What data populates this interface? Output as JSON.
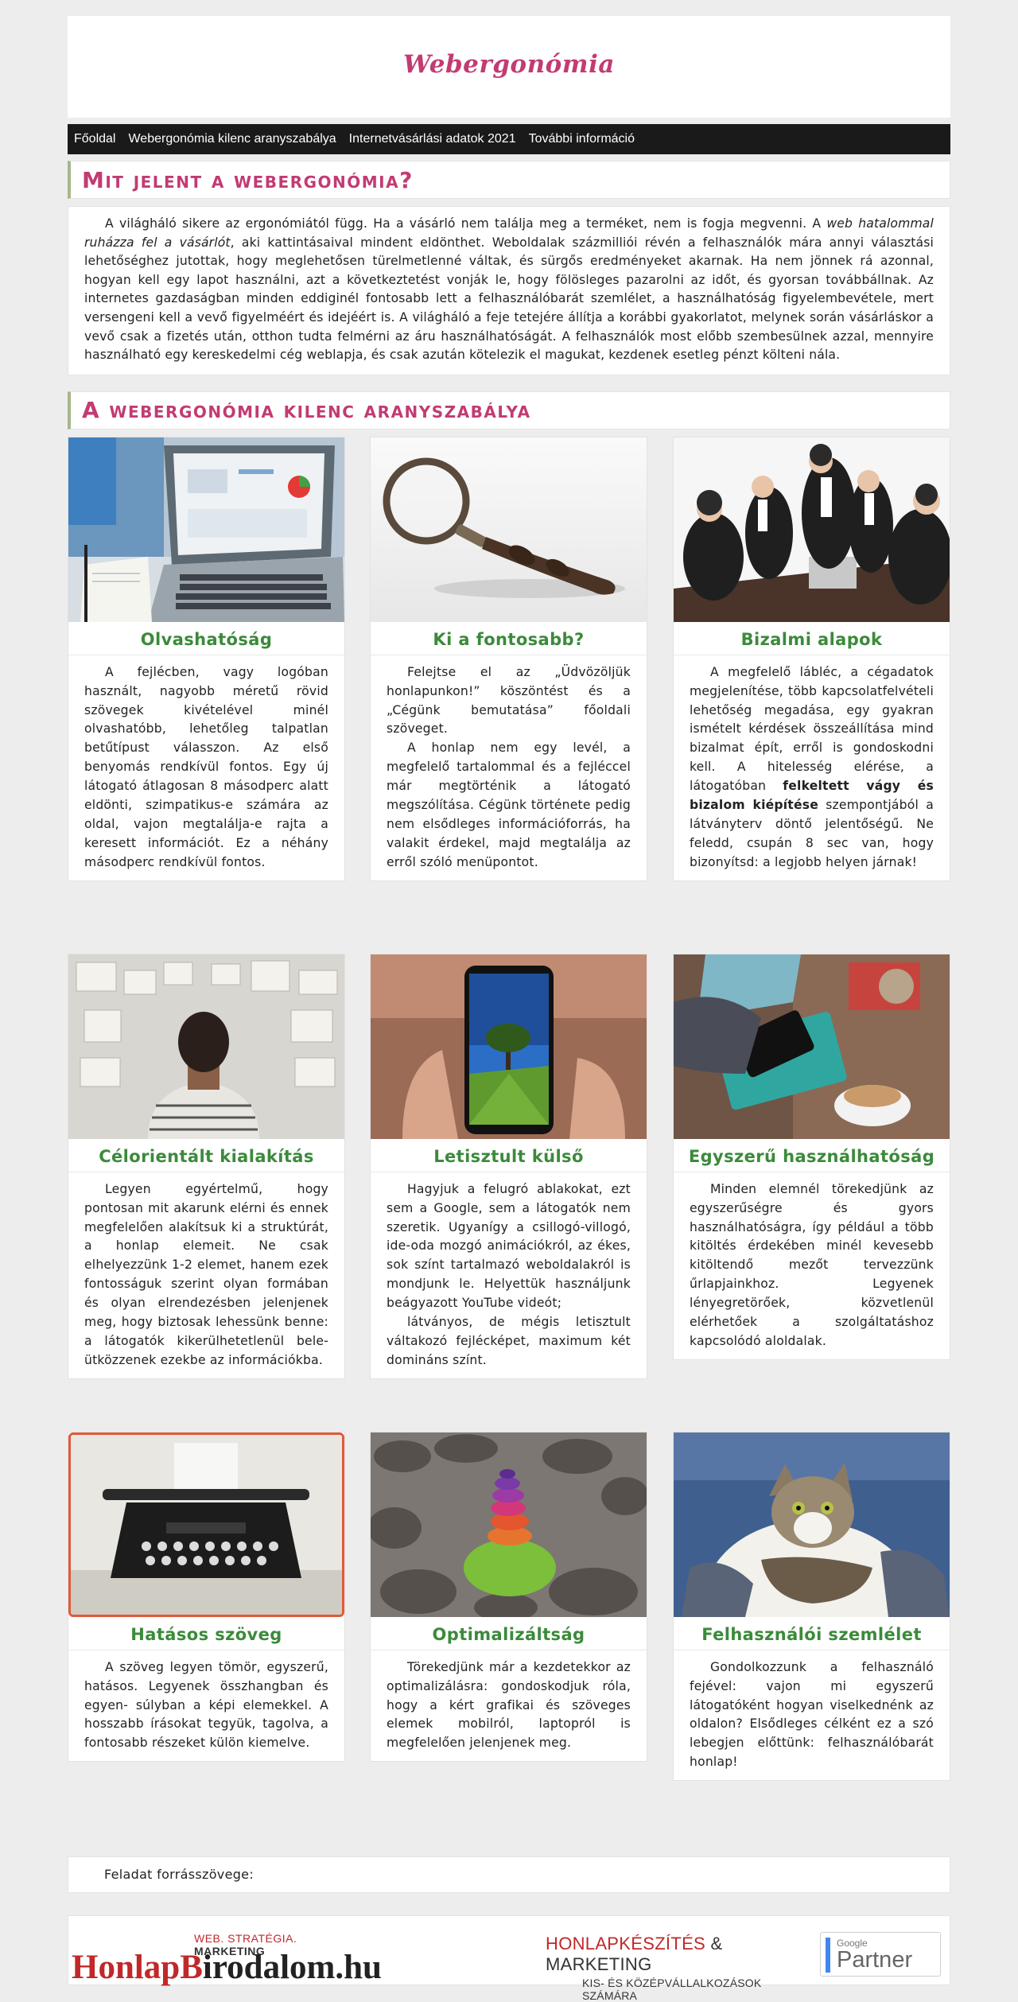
{
  "site": {
    "brand": "Webergonómia"
  },
  "nav": [
    "Főoldal",
    "Webergonómia kilenc aranyszabálya",
    "Internetvásárlási adatok 2021",
    "További információ"
  ],
  "intro": {
    "title": "Mit jelent a webergonómia?",
    "p1": "A világháló sikere az ergonómiától függ. Ha a vásárló nem találja meg a terméket, nem is fogja megvenni. A ",
    "p_em": "web hatalommal ruházza fel a vásárlót",
    "p2": ", aki kattintásaival mindent eldönthet. Weboldalak százmilliói révén a felhasználók mára annyi választási lehetőséghez jutottak, hogy meglehetősen türelmetlenné váltak, és sürgős eredményeket akarnak. Ha nem jönnek rá azonnal, hogyan kell egy lapot használni, azt a következtetést vonják le, hogy fölösleges pazarolni az időt, és gyorsan továbbállnak. Az internetes gazdaságban minden eddiginél fontosabb lett a felhasználóbarát szemlélet, a használhatóság figyelembevétele, mert versengeni kell a vevő figyelméért és idejéért is. A világháló a feje tetejére állítja a korábbi gyakorlatot, melynek során vásárláskor a vevő csak a fizetés után, otthon tudta felmérni az áru használhatóságát. A felhasználók most előbb szembesülnek azzal, mennyire használható egy kereskedelmi cég weblapja, és csak azután kötelezik el magukat, kezdenek esetleg pénzt költeni nála."
  },
  "rules_title": "A webergonómia kilenc aranyszabálya",
  "cards": [
    {
      "title": "Olvashatóság",
      "image": "laptop-desk-photo",
      "text": "A fejlécben, vagy logóban használt, nagyobb méretű rövid szövegek kivételével minél olvashatóbb, lehetőleg talpatlan betűtípust válasszon. Az első benyomás rendkívül fontos. Egy új látogató átlagosan 8 másodperc alatt eldönti, szimpatikus-e számára az oldal, vajon megtalálja-e rajta a keresett információt. Ez a néhány másodperc rendkívül fontos."
    },
    {
      "title": "Ki a fontosabb?",
      "image": "magnifying-glass-photo",
      "text_a": "Felejtse el az „Üdvözöljük honlapunkon!” köszöntést és a „Cégünk bemutatása” főoldali szöveget.",
      "text_b": "A honlap nem egy levél, a megfelelő tartalommal és a fejléccel már megtörténik a látogató megszólítása. Cégünk története pedig nem elsődleges információforrás, ha valakit érdekel, majd megtalálja az erről szóló menüpontot."
    },
    {
      "title": "Bizalmi alapok",
      "image": "business-meeting-photo",
      "text_a": "A megfelelő lábléc, a cégadatok megjelenítése, több kapcsolatfelvételi lehetőség megadása, egy gyakran ismételt kérdések összeállítása mind bizalmat épít, erről is gondoskodni kell. A hitelesség elérése, a látogatóban ",
      "text_bold": "felkeltett vágy és bizalom kiépítése",
      "text_b": " szempontjából a látványterv döntő jelentőségű. Ne feledd, csupán 8 sec van, hogy bizonyítsd: a legjobb helyen járnak!"
    },
    {
      "title": "Célorientált kialakítás",
      "image": "man-looking-at-wall-photo",
      "text": "Legyen egyértelmű, hogy pontosan mit akarunk elérni és ennek megfelelően alakítsuk ki a struktúrát, a honlap elemeit. Ne csak elhelyezzünk 1-2 elemet, hanem ezek fontosságuk szerint olyan formában és olyan elrendezésben jelenjenek meg, hogy biztosak lehessünk benne: a látogatók kikerülhetetlenül bele-ütközzenek ezekbe az információkba."
    },
    {
      "title": "Letisztult külső",
      "image": "phone-tree-photo",
      "text_a": "Hagyjuk a felugró ablakokat, ezt sem a Google, sem a látogatók nem szeretik. Ugyanígy a csillogó-villogó, ide-oda mozgó animációkról, az ékes, sok színt tartalmazó weboldalakról is mondjunk le. Helyettük használjunk beágyazott YouTube videót;",
      "text_b": "látványos, de mégis letisztult váltakozó fejlécképet, maximum két domináns színt."
    },
    {
      "title": "Egyszerű használhatóság",
      "image": "phone-coffee-photo",
      "text": "Minden elemnél törekedjünk az egyszerűségre és gyors használhatóságra, így például a több kitöltés érdekében minél kevesebb kitöltendő mezőt tervezzünk űrlapjainkhoz. Legyenek lényegretörőek, közvetlenül elérhetőek a szolgáltatáshoz kapcsolódó aloldalak."
    },
    {
      "title": "Hatásos szöveg",
      "image": "typewriter-photo",
      "text": "A szöveg legyen tömör, egyszerű, hatásos. Legyenek összhangban és egyen- súlyban a képi elemekkel. A hosszabb írásokat tegyük, tagolva, a fontosabb részeket külön kiemelve."
    },
    {
      "title": "Optimalizáltság",
      "image": "stacked-stones-photo",
      "text": "Törekedjünk már a kezdetekkor az optimalizálásra: gondoskodjuk róla, hogy a kért grafikai és szöveges elemek mobilról, laptopról is megfelelően jelenjenek meg."
    },
    {
      "title": "Felhasználói szemlélet",
      "image": "cat-photo",
      "text": "Gondolkozzunk a felhasználó fejével: vajon mi egyszerű látogatóként hogyan viselkednénk az oldalon? Elsődleges célként ez a szó lebegjen előttünk: felhasználóbarát honlap!"
    }
  ],
  "source_label": "Feladat forrásszövege:",
  "footer": {
    "logo_tag_a": "WEB.",
    "logo_tag_b": "STRATÉGIA.",
    "logo_tag_c": "MARKETING",
    "logo_word_a": "HonlapB",
    "logo_word_b": "irodalom.hu",
    "marketing_a": "HONLAPKÉSZÍTÉS",
    "marketing_amp": "& MARKETING",
    "marketing_b": "KIS- ÉS KÖZÉPVÁLLALKOZÁSOK SZÁMÁRA",
    "badge_top": "Google",
    "badge_main": "Partner"
  }
}
